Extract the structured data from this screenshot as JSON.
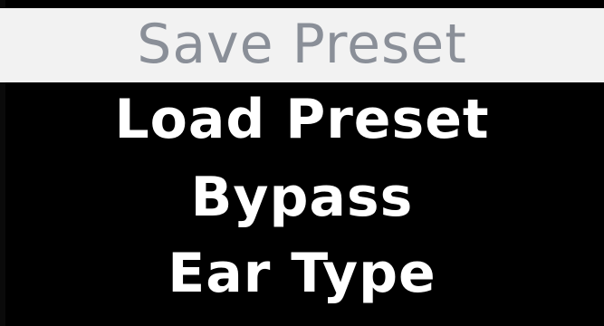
{
  "menu": {
    "items": [
      {
        "label": "Save Preset",
        "selected": true
      },
      {
        "label": "Load Preset",
        "selected": false
      },
      {
        "label": "Bypass",
        "selected": false
      },
      {
        "label": "Ear Type",
        "selected": false
      }
    ]
  },
  "colors": {
    "background": "#000000",
    "selection_background": "#f2f2f2",
    "selected_text": "#8a8f98",
    "text": "#ffffff"
  }
}
